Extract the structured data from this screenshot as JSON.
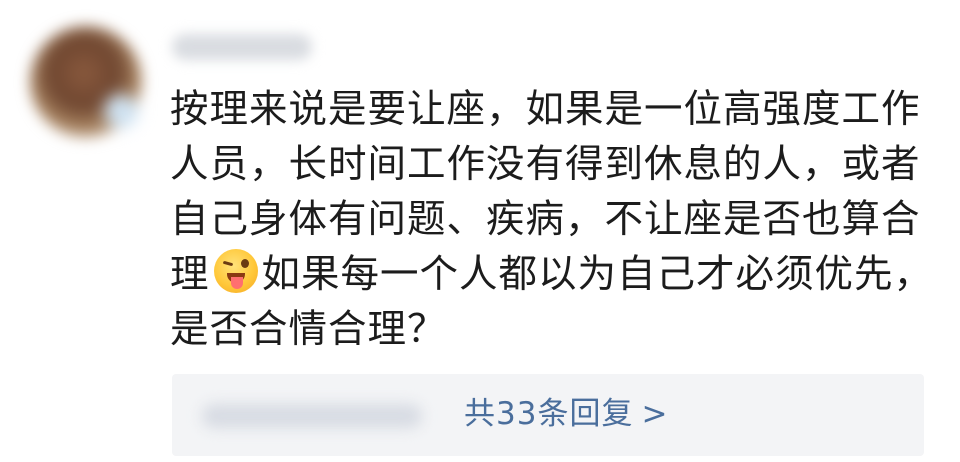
{
  "comment": {
    "text_before_emoji": "按理来说是要让座，如果是一位高强度工作人员，长时间工作没有得到休息的人，或者自己身体有问题、疾病，不让座是否也算合理",
    "emoji_icon": "winking-tongue-emoji",
    "text_after_emoji": "如果每一个人都以为自己才必须优先，是否合情合理？"
  },
  "replies": {
    "link_text": "共33条回复",
    "chevron": ">",
    "link_color": "#4a6e9c"
  },
  "colors": {
    "text": "#1c1c1c",
    "reply_bg": "#f3f4f6",
    "background": "#ffffff"
  }
}
